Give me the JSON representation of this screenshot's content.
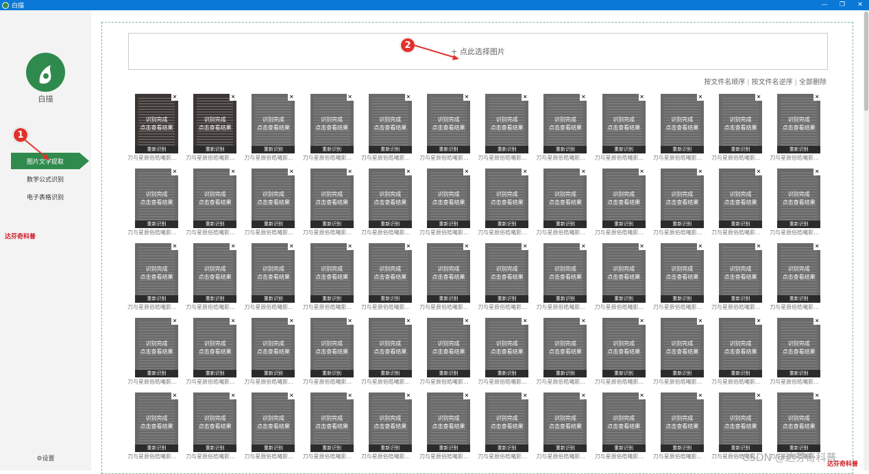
{
  "window": {
    "title": "白描",
    "minimize_glyph": "—",
    "restore_glyph": "❐",
    "close_glyph": "✕"
  },
  "sidebar": {
    "logo_label": "白描",
    "items": [
      {
        "label": "图片文字提取",
        "active": true
      },
      {
        "label": "数学公式识别",
        "active": false
      },
      {
        "label": "电子表格识别",
        "active": false
      }
    ],
    "settings_label": "⚙设置",
    "watermark": "达芬奇科普"
  },
  "markers": {
    "one": "1",
    "two": "2"
  },
  "upload": {
    "label": "+ 点此选择图片"
  },
  "sort": {
    "by_name": "按文件名顺序",
    "by_name_reverse": "按文件名逆序",
    "delete_all": "全部删除",
    "separator": "|"
  },
  "thumbnail": {
    "status_line1": "识别完成",
    "status_line2": "点击查看结果",
    "retry_label": "重新识别",
    "close_glyph": "✕",
    "caption": "刀与星辰俗皓曦影..."
  },
  "grid": {
    "columns": 12,
    "rows": 5,
    "dark_cells": [
      0,
      1
    ]
  },
  "watermark": {
    "csdn": "CSDN @达芬奇科普",
    "red": "达芬奇科普"
  }
}
